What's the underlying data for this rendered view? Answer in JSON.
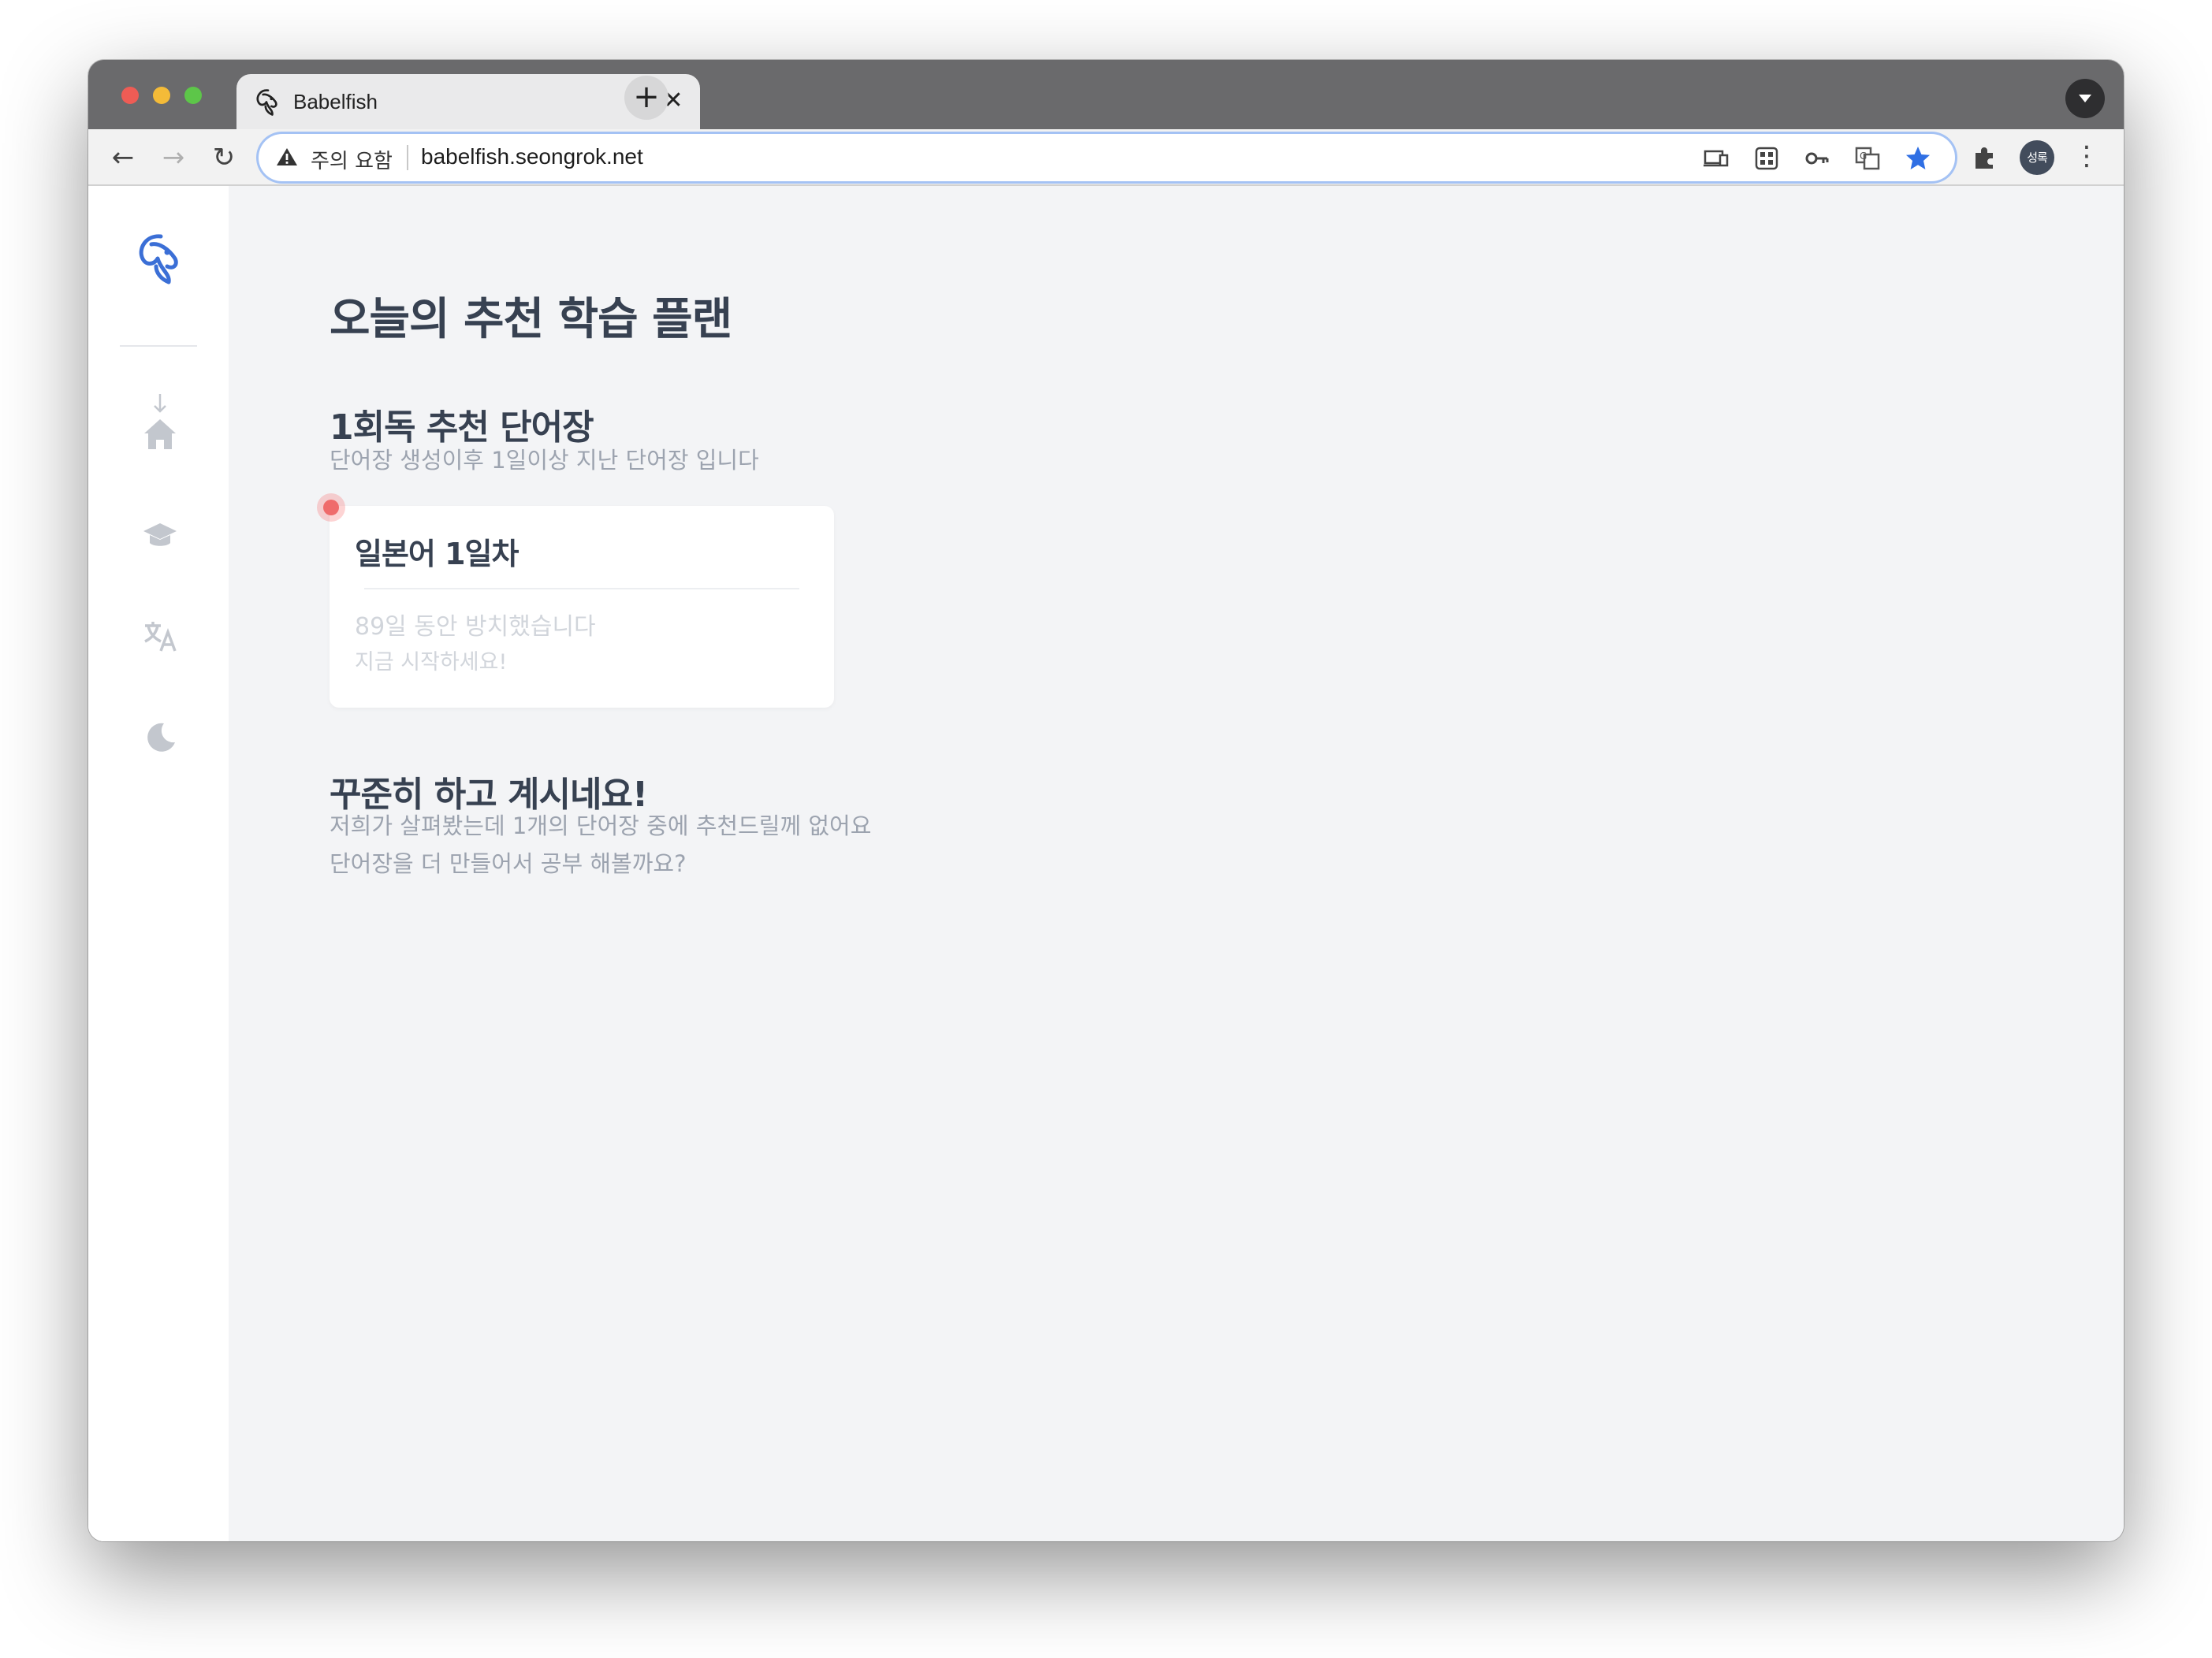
{
  "browser": {
    "tab_title": "Babelfish",
    "tab_close": "✕",
    "new_tab": "+",
    "security_label": "주의 요함",
    "url": "babelfish.seongrok.net",
    "profile_name": "성록",
    "menu": "⋮",
    "back": "←",
    "forward": "→",
    "reload": "↻"
  },
  "page": {
    "title": "오늘의 추천 학습 플랜",
    "sections": [
      {
        "title": "1회독 추천 단어장",
        "description": "단어장 생성이후 1일이상 지난 단어장 입니다"
      },
      {
        "title": "꾸준히 하고 계시네요!",
        "description_line1": "저희가 살펴봤는데 1개의 단어장 중에 추천드릴께 없어요",
        "description_line2": "단어장을 더 만들어서 공부 해볼까요?"
      }
    ],
    "card": {
      "title": "일본어 1일차",
      "line1": "89일 동안 방치했습니다",
      "line2": "지금 시작하세요!"
    }
  },
  "colors": {
    "accent_blue": "#3b6fd6",
    "heading": "#374151",
    "muted": "#9ca3af",
    "faint": "#d1d5db",
    "notification_dot": "#ef6b6b",
    "background": "#f3f4f6"
  },
  "icons": {
    "logo": "babelfish-logo-icon",
    "nav": [
      "home-icon",
      "graduation-cap-icon",
      "translate-icon",
      "moon-icon"
    ]
  }
}
